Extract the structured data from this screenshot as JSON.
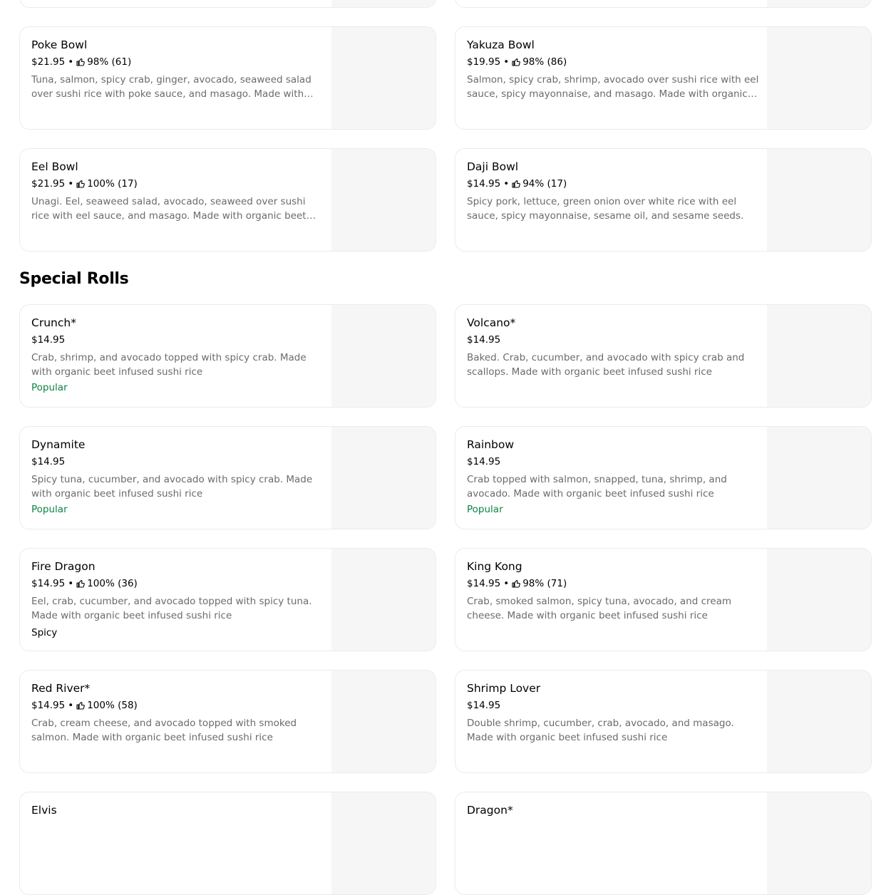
{
  "bowls": [
    {
      "name": "Poke Bowl",
      "price": "$21.95",
      "rating": "98% (61)",
      "description": "Tuna, salmon, spicy crab, ginger, avocado, seaweed salad over sushi rice with poke sauce, and masago. Made with organic beet infused sushi rice"
    },
    {
      "name": "Yakuza Bowl",
      "price": "$19.95",
      "rating": "98% (86)",
      "description": "Salmon, spicy crab, shrimp, avocado over sushi rice with eel sauce, spicy mayonnaise, and masago. Made with organic beet infused sushi rice"
    },
    {
      "name": "Eel Bowl",
      "price": "$21.95",
      "rating": "100% (17)",
      "description": "Unagi. Eel, seaweed salad, avocado, seaweed over sushi rice with eel sauce, and masago. Made with organic beet infused sushi rice"
    },
    {
      "name": "Daji Bowl",
      "price": "$14.95",
      "rating": "94% (17)",
      "description": "Spicy pork, lettuce, green onion over white rice with eel sauce, spicy mayonnaise, sesame oil, and sesame seeds."
    }
  ],
  "special_rolls_title": "Special Rolls",
  "rolls": [
    {
      "name": "Crunch*",
      "price": "$14.95",
      "description": "Crab, shrimp, and avocado topped with spicy crab. Made with organic beet infused sushi rice",
      "badge": "Popular"
    },
    {
      "name": "Volcano*",
      "price": "$14.95",
      "description": "Baked. Crab, cucumber, and avocado with spicy crab and scallops. Made with organic beet infused sushi rice"
    },
    {
      "name": "Dynamite",
      "price": "$14.95",
      "description": "Spicy tuna, cucumber, and avocado with spicy crab. Made with organic beet infused sushi rice",
      "badge": "Popular"
    },
    {
      "name": "Rainbow",
      "price": "$14.95",
      "description": "Crab topped with salmon, snapped, tuna, shrimp, and avocado. Made with organic beet infused sushi rice",
      "badge": "Popular"
    },
    {
      "name": "Fire Dragon",
      "price": "$14.95",
      "rating": "100% (36)",
      "description": "Eel, crab, cucumber, and avocado topped with spicy tuna. Made with organic beet infused sushi rice",
      "tag": "Spicy"
    },
    {
      "name": "King Kong",
      "price": "$14.95",
      "rating": "98% (71)",
      "description": "Crab, smoked salmon, spicy tuna, avocado, and cream cheese. Made with organic beet infused sushi rice"
    },
    {
      "name": "Red River*",
      "price": "$14.95",
      "rating": "100% (58)",
      "description": "Crab, cream cheese, and avocado topped with smoked salmon. Made with organic beet infused sushi rice"
    },
    {
      "name": "Shrimp Lover",
      "price": "$14.95",
      "description": "Double shrimp, cucumber, crab, avocado, and masago. Made with organic beet infused sushi rice"
    },
    {
      "name": "Elvis"
    },
    {
      "name": "Dragon*"
    }
  ],
  "colors": {
    "popular": "#0e8345",
    "description": "#6b6b6b",
    "card_border": "#ebebeb",
    "image_placeholder": "#f6f6f6"
  },
  "icons": {
    "rating": "thumbs-up-icon"
  }
}
